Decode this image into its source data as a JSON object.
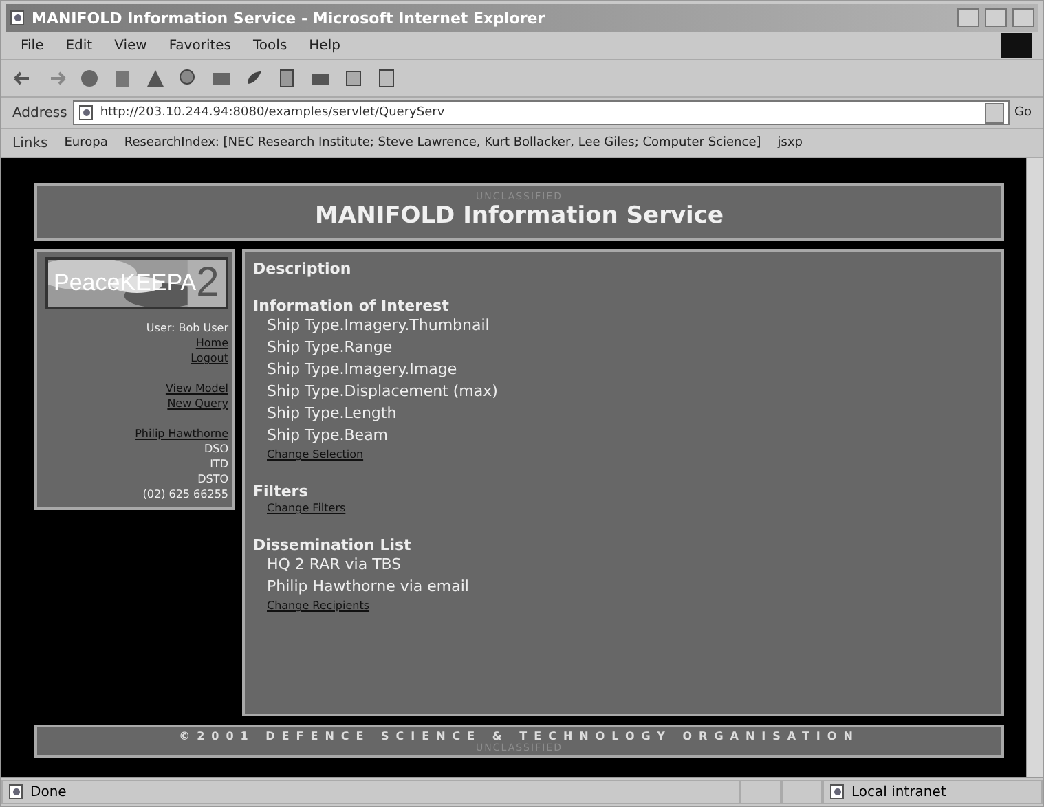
{
  "window": {
    "title": "MANIFOLD Information Service - Microsoft Internet Explorer"
  },
  "menu": [
    "File",
    "Edit",
    "View",
    "Favorites",
    "Tools",
    "Help"
  ],
  "address_bar": {
    "label": "Address",
    "value": "http://203.10.244.94:8080/examples/servlet/QueryServ",
    "go": "Go"
  },
  "links_bar": {
    "label": "Links",
    "links": [
      "Europa",
      "ResearchIndex: [NEC Research Institute; Steve Lawrence, Kurt Bollacker, Lee Giles; Computer Science]",
      "jsxp"
    ]
  },
  "header": {
    "classification": "UNCLASSIFIED",
    "title": "MANIFOLD Information Service"
  },
  "sidebar": {
    "logo": {
      "text": "PeaceKEEPA",
      "suffix": "2"
    },
    "items": [
      {
        "kind": "text",
        "text": "User: Bob User"
      },
      {
        "kind": "link",
        "text": "Home"
      },
      {
        "kind": "link",
        "text": "Logout"
      },
      {
        "kind": "gap"
      },
      {
        "kind": "link",
        "text": "View Model"
      },
      {
        "kind": "link",
        "text": "New Query"
      },
      {
        "kind": "gap"
      },
      {
        "kind": "link",
        "text": "Philip Hawthorne"
      },
      {
        "kind": "text",
        "text": "DSO"
      },
      {
        "kind": "text",
        "text": "ITD"
      },
      {
        "kind": "text",
        "text": "DSTO"
      },
      {
        "kind": "text",
        "text": "(02) 625 66255"
      }
    ]
  },
  "main": {
    "sections": [
      {
        "heading": "Description"
      },
      {
        "heading": "Information of Interest",
        "items": [
          "Ship Type.Imagery.Thumbnail",
          "Ship Type.Range",
          "Ship Type.Imagery.Image",
          "Ship Type.Displacement (max)",
          "Ship Type.Length",
          "Ship Type.Beam"
        ],
        "link": "Change Selection"
      },
      {
        "heading": "Filters",
        "link": "Change Filters"
      },
      {
        "heading": "Dissemination List",
        "items": [
          "HQ 2 RAR via TBS",
          "Philip Hawthorne via email"
        ],
        "link": "Change Recipients"
      }
    ]
  },
  "footer": {
    "copyright": "©2001 DEFENCE SCIENCE & TECHNOLOGY ORGANISATION",
    "classification": "UNCLASSIFIED"
  },
  "status_bar": {
    "status": "Done",
    "zone": "Local intranet"
  }
}
